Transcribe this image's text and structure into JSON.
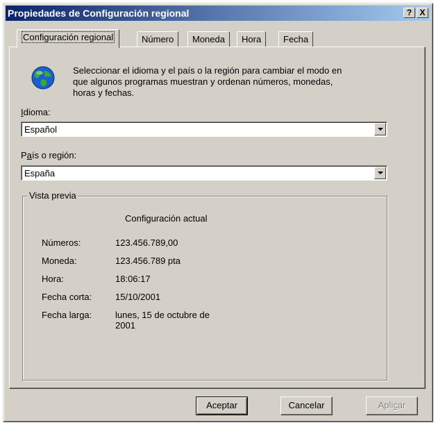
{
  "window": {
    "title": "Propiedades de Configuración regional",
    "help_btn": "?",
    "close_btn": "X"
  },
  "tabs": [
    {
      "label": "Configuración regional",
      "active": true
    },
    {
      "label": "Número"
    },
    {
      "label": "Moneda"
    },
    {
      "label": "Hora"
    },
    {
      "label": "Fecha"
    }
  ],
  "intro": {
    "icon": "globe-icon",
    "lines": [
      "Seleccionar el idioma y el país o la región para cambiar el modo en",
      "que algunos programas muestran y ordenan números, monedas,",
      "horas y fechas."
    ]
  },
  "language": {
    "label_accel": "I",
    "label_rest": "dioma:",
    "value": "Español"
  },
  "region": {
    "label_pre": "P",
    "label_accel": "a",
    "label_rest": "ís o región:",
    "value": "España"
  },
  "preview": {
    "legend": "Vista previa",
    "column_header": "Configuración actual",
    "rows": [
      {
        "label": "Números:",
        "value": "123.456.789,00"
      },
      {
        "label": "Moneda:",
        "value": "123.456.789 pta"
      },
      {
        "label": "Hora:",
        "value": "18:06:17"
      },
      {
        "label": "Fecha corta:",
        "value": "15/10/2001"
      },
      {
        "label": "Fecha larga:",
        "value_line1": "lunes, 15 de octubre de",
        "value_line2": "2001"
      }
    ]
  },
  "buttons": {
    "ok": "Aceptar",
    "cancel": "Cancelar",
    "apply_pre": "Apli",
    "apply_accel": "c",
    "apply_rest": "ar"
  },
  "colors": {
    "titlebar_start": "#0a246a",
    "titlebar_end": "#a6caf0",
    "face": "#d4d0c8"
  }
}
